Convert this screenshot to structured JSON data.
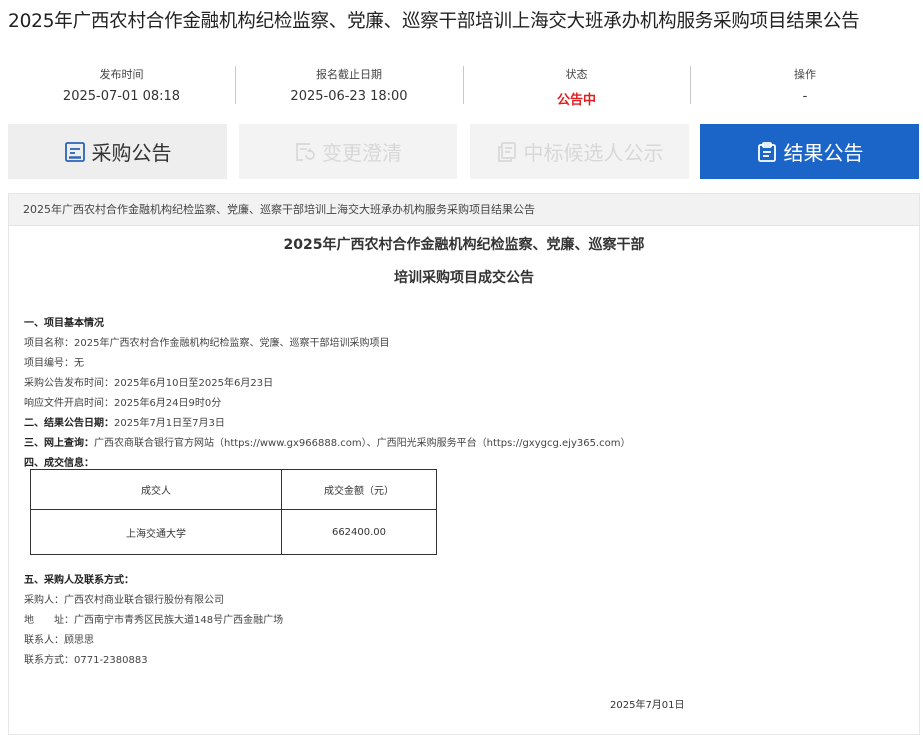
{
  "page": {
    "title": "2025年广西农村合作金融机构纪检监察、党廉、巡察干部培训上海交大班承办机构服务采购项目结果公告"
  },
  "meta": {
    "publish_label": "发布时间",
    "publish_value": "2025-07-01 08:18",
    "deadline_label": "报名截止日期",
    "deadline_value": "2025-06-23 18:00",
    "status_label": "状态",
    "status_value": "公告中",
    "action_label": "操作",
    "action_value": "-"
  },
  "tabs": [
    {
      "label": "采购公告",
      "icon": "document-icon"
    },
    {
      "label": "变更澄清",
      "icon": "refresh-document-icon"
    },
    {
      "label": "中标候选人公示",
      "icon": "copy-document-icon"
    },
    {
      "label": "结果公告",
      "icon": "clipboard-icon"
    }
  ],
  "colors": {
    "accent": "#1b64c8",
    "status": "#e02020"
  },
  "notice": {
    "breadcrumb": "2025年广西农村合作金融机构纪检监察、党廉、巡察干部培训上海交大班承办机构服务采购项目结果公告",
    "title_line1": "2025年广西农村合作金融机构纪检监察、党廉、巡察干部",
    "title_line2": "培训采购项目成交公告",
    "s1_heading": "一、项目基本情况",
    "project_name": "项目名称：2025年广西农村合作金融机构纪检监察、党廉、巡察干部培训采购项目",
    "project_no": "项目编号：无",
    "publish_period": "采购公告发布时间：2025年6月10日至2025年6月23日",
    "open_time": "响应文件开启时间：2025年6月24日9时0分",
    "s2_heading": "二、结果公告日期：",
    "s2_value": "2025年7月1日至7月3日",
    "s3_heading": "三、网上查询：",
    "s3_value": "广西农商联合银行官方网站（https://www.gx966888.com）、广西阳光采购服务平台（https://gxygcg.ejy365.com）",
    "s4_heading": "四、成交信息：",
    "table": {
      "headers": [
        "成交人",
        "成交金额（元）"
      ],
      "rows": [
        [
          "上海交通大学",
          "662400.00"
        ]
      ]
    },
    "s5_heading": "五、采购人及联系方式：",
    "buyer": "采购人：广西农村商业联合银行股份有限公司",
    "address_label": "地　　址：",
    "address_value": "广西南宁市青秀区民族大道148号广西金融广场",
    "contact": "联系人：顾思思",
    "phone": "联系方式：0771-2380883",
    "date": "2025年7月01日"
  }
}
